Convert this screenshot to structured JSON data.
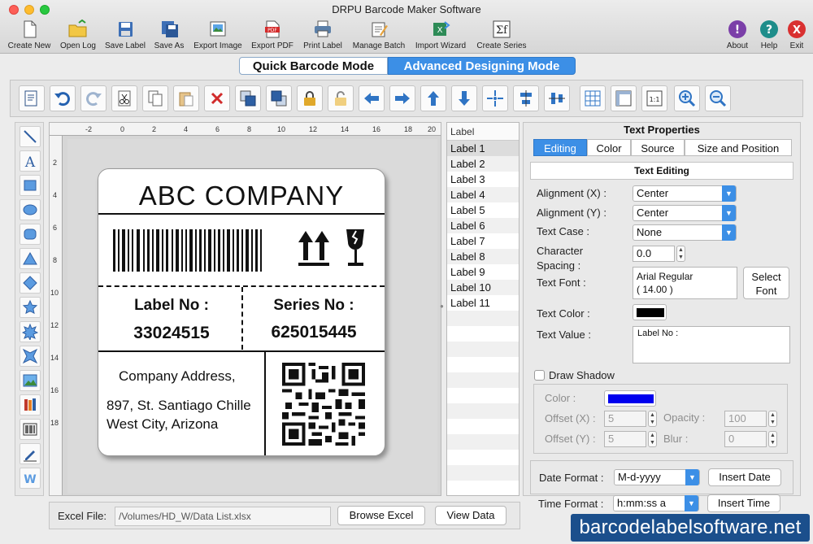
{
  "window": {
    "title": "DRPU Barcode Maker Software"
  },
  "toolbar": {
    "create_new": "Create New",
    "open_log": "Open Log",
    "save_label": "Save Label",
    "save_as": "Save As",
    "export_image": "Export Image",
    "export_pdf": "Export PDF",
    "print_label": "Print Label",
    "manage_batch": "Manage Batch",
    "import_wizard": "Import Wizard",
    "create_series": "Create Series",
    "about": "About",
    "help": "Help",
    "exit": "Exit"
  },
  "modes": {
    "quick": "Quick Barcode Mode",
    "advanced": "Advanced Designing Mode",
    "active": "advanced"
  },
  "ruler": {
    "h_ticks": [
      "-2",
      "0",
      "2",
      "4",
      "6",
      "8",
      "10",
      "12",
      "14",
      "16",
      "18",
      "20"
    ],
    "v_ticks": [
      "2",
      "4",
      "6",
      "8",
      "10",
      "12",
      "14",
      "16",
      "18"
    ]
  },
  "label_design": {
    "company": "ABC COMPANY",
    "label_no_caption": "Label No :",
    "label_no_value": "33024515",
    "series_no_caption": "Series No :",
    "series_no_value": "625015445",
    "address_caption": "Company Address,",
    "address_line1": "897, St. Santiago Chille",
    "address_line2": "West City, Arizona"
  },
  "label_list": {
    "header": "Label",
    "items": [
      "Label 1",
      "Label 2",
      "Label 3",
      "Label 4",
      "Label 5",
      "Label 6",
      "Label 7",
      "Label 8",
      "Label 9",
      "Label 10",
      "Label 11"
    ],
    "selected_index": 0
  },
  "properties": {
    "title": "Text Properties",
    "tabs": [
      "Editing",
      "Color",
      "Source",
      "Size and Position"
    ],
    "active_tab": "Editing",
    "section": "Text Editing",
    "alignment_x_label": "Alignment (X) :",
    "alignment_x": "Center",
    "alignment_y_label": "Alignment (Y) :",
    "alignment_y": "Center",
    "text_case_label": "Text Case :",
    "text_case": "None",
    "char_spacing_label_1": "Character",
    "char_spacing_label_2": "Spacing :",
    "char_spacing": "0.0",
    "text_font_label": "Text Font :",
    "font_name": "Arial Regular",
    "font_size": "( 14.00 )",
    "select_font": "Select Font",
    "text_color_label": "Text Color :",
    "text_color": "#000000",
    "text_value_label": "Text Value :",
    "text_value": "Label No :",
    "draw_shadow": "Draw Shadow",
    "shadow_color_label": "Color :",
    "shadow_color": "#0000ee",
    "offset_x_label": "Offset (X) :",
    "offset_x": "5",
    "offset_y_label": "Offset (Y) :",
    "offset_y": "5",
    "opacity_label": "Opacity :",
    "opacity": "100",
    "blur_label": "Blur :",
    "blur": "0",
    "date_format_label": "Date Format :",
    "date_format": "M-d-yyyy",
    "insert_date": "Insert Date",
    "time_format_label": "Time Format :",
    "time_format": "h:mm:ss a",
    "insert_time": "Insert Time"
  },
  "bottom": {
    "excel_label": "Excel File:",
    "excel_path": "/Volumes/HD_W/Data List.xlsx",
    "browse_excel": "Browse Excel",
    "view_data": "View Data"
  },
  "watermark": "barcodelabelsoftware.net",
  "colors": {
    "accent": "#3c8fe6",
    "watermark_bg": "#1b4f8c"
  }
}
